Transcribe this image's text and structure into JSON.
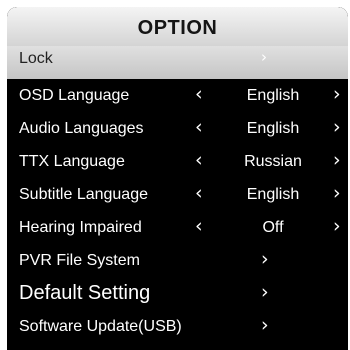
{
  "menu": {
    "title": "OPTION",
    "rows": [
      {
        "label": "Lock",
        "submenu_arrow": "›"
      },
      {
        "label": "OSD Language",
        "prev_arrow": "‹",
        "value": "English",
        "next_arrow": "›"
      },
      {
        "label": "Audio Languages",
        "prev_arrow": "‹",
        "value": "English",
        "next_arrow": "›"
      },
      {
        "label": "TTX Language",
        "prev_arrow": "‹",
        "value": "Russian",
        "next_arrow": "›"
      },
      {
        "label": "Subtitle Language",
        "prev_arrow": "‹",
        "value": "English",
        "next_arrow": "›"
      },
      {
        "label": "Hearing Impaired",
        "prev_arrow": "‹",
        "value": "Off",
        "next_arrow": "›"
      },
      {
        "label": "PVR File System",
        "submenu_arrow": "›"
      },
      {
        "label": "Default Setting",
        "submenu_arrow": "›"
      },
      {
        "label": "Software Update(USB)",
        "submenu_arrow": "›"
      }
    ]
  },
  "colors": {
    "panel_background": "#000000",
    "header_background": "#e4e4e4",
    "selected_row_background": "#d2d2d2",
    "text": "#ffffff"
  },
  "icons": {
    "submenu": "chevron-right-icon",
    "prev": "chevron-left-icon",
    "next": "chevron-right-icon"
  }
}
